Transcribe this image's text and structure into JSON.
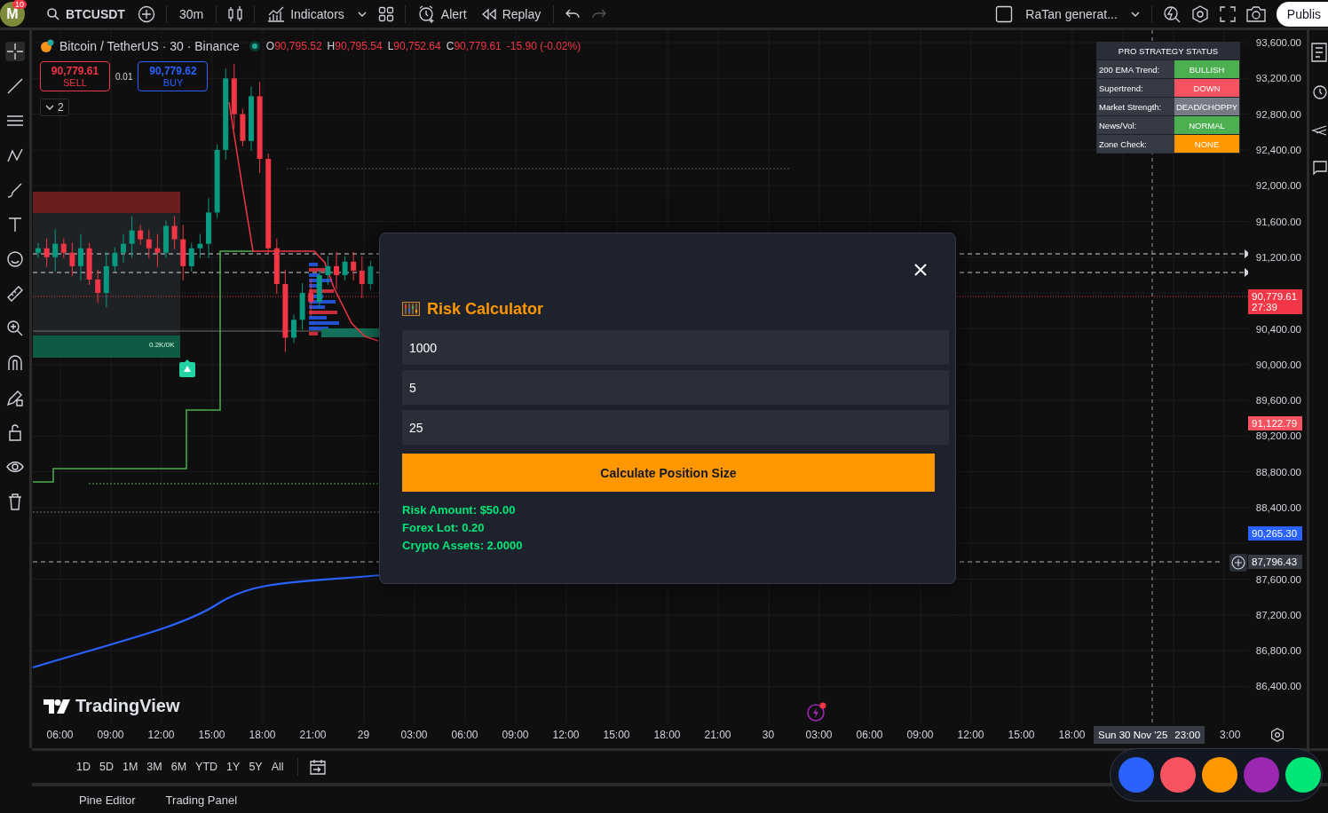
{
  "toolbar": {
    "avatar_letter": "M",
    "notification_count": "10",
    "symbol": "BTCUSDT",
    "interval": "30m",
    "indicators": "Indicators",
    "alert": "Alert",
    "replay": "Replay",
    "layout_name": "RaTan generat...",
    "publish": "Publis"
  },
  "legend": {
    "title": "Bitcoin / TetherUS · 30 · Binance",
    "ohlc": [
      {
        "label": "O",
        "value": "90,795.52"
      },
      {
        "label": "H",
        "value": "90,795.54"
      },
      {
        "label": "L",
        "value": "90,752.64"
      },
      {
        "label": "C",
        "value": "90,779.61"
      }
    ],
    "change": "-15.90 (-0.02%)"
  },
  "trade": {
    "sell_price": "90,779.61",
    "sell_label": "SELL",
    "spread": "0.01",
    "buy_price": "90,779.62",
    "buy_label": "BUY",
    "collapse_count": "2"
  },
  "zone_label": "0.2K/0K",
  "strategy_table": {
    "title": "PRO STRATEGY STATUS",
    "rows": [
      {
        "label": "200 EMA Trend:",
        "value": "BULLISH",
        "color": "#4caf50"
      },
      {
        "label": "Supertrend:",
        "value": "DOWN",
        "color": "#f7525f"
      },
      {
        "label": "Market Strength:",
        "value": "DEAD/CHOPPY",
        "color": "#787b86"
      },
      {
        "label": "News/Vol:",
        "value": "NORMAL",
        "color": "#4caf50"
      },
      {
        "label": "Zone Check:",
        "value": "NONE",
        "color": "#ff9800"
      }
    ]
  },
  "price_axis": {
    "ticks": [
      "93,600.00",
      "93,200.00",
      "92,800.00",
      "92,400.00",
      "92,000.00",
      "91,600.00",
      "91,200.00",
      "90,400.00",
      "90,000.00",
      "89,600.00",
      "89,200.00",
      "88,800.00",
      "88,400.00",
      "87,600.00",
      "87,200.00",
      "86,800.00",
      "86,400.00"
    ],
    "tags": [
      {
        "value": "90,779.61",
        "sub": "27:39",
        "color": "#f23645"
      },
      {
        "value": "91,122.79",
        "color": "#f7525f"
      },
      {
        "value": "90,265.30",
        "color": "#2962ff"
      },
      {
        "value": "87,796.43",
        "color": "#363a45"
      }
    ]
  },
  "logo": "TradingView",
  "time_axis": {
    "ticks": [
      "06:00",
      "09:00",
      "12:00",
      "15:00",
      "18:00",
      "21:00",
      "29",
      "03:00",
      "06:00",
      "09:00",
      "12:00",
      "15:00",
      "18:00",
      "21:00",
      "30",
      "03:00",
      "06:00",
      "09:00",
      "12:00",
      "15:00",
      "18:00"
    ],
    "crosshair_date": "Sun 30 Nov '25",
    "crosshair_time": "23:00",
    "partial_tick": "3:00"
  },
  "range_buttons": [
    "1D",
    "5D",
    "1M",
    "3M",
    "6M",
    "YTD",
    "1Y",
    "5Y",
    "All"
  ],
  "bottom_tabs": [
    "Pine Editor",
    "Trading Panel"
  ],
  "dialog": {
    "title": "Risk Calculator",
    "inputs": [
      "1000",
      "5",
      "25"
    ],
    "button": "Calculate Position Size",
    "results": [
      "Risk Amount: $50.00",
      "Forex Lot: 0.20",
      "Crypto Assets: 2.0000"
    ]
  },
  "dock": [
    {
      "color": "#2962ff"
    },
    {
      "color": "#f7525f"
    },
    {
      "color": "#ff9800"
    },
    {
      "color": "#9c27b0"
    },
    {
      "color": "#00e676"
    }
  ]
}
